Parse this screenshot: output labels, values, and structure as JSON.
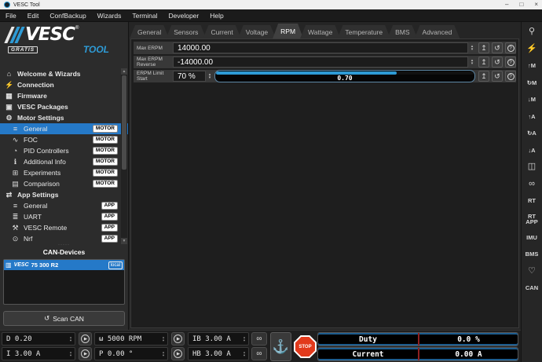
{
  "window": {
    "title": "VESC Tool",
    "controls": {
      "minimize": "–",
      "maximize": "□",
      "close": "×"
    }
  },
  "menu_bar": {
    "items": [
      "File",
      "Edit",
      "ConfBackup",
      "Wizards",
      "Terminal",
      "Developer",
      "Help"
    ]
  },
  "sidebar": {
    "logo": {
      "brand": "VESC",
      "registered": "®",
      "badge": "GRATIS",
      "sub": "TOOL"
    },
    "nav": [
      {
        "icon": "⌂",
        "label": "Welcome & Wizards",
        "badge": ""
      },
      {
        "icon": "⚡",
        "label": "Connection",
        "badge": ""
      },
      {
        "icon": "▦",
        "label": "Firmware",
        "badge": ""
      },
      {
        "icon": "▣",
        "label": "VESC Packages",
        "badge": ""
      },
      {
        "icon": "⚙",
        "label": "Motor Settings",
        "badge": ""
      },
      {
        "icon": "≡",
        "label": "General",
        "badge": "MOTOR"
      },
      {
        "icon": "∿",
        "label": "FOC",
        "badge": "MOTOR"
      },
      {
        "icon": "◔",
        "label": "PID Controllers",
        "badge": "MOTOR"
      },
      {
        "icon": "ℹ",
        "label": "Additional Info",
        "badge": "MOTOR"
      },
      {
        "icon": "⊞",
        "label": "Experiments",
        "badge": "MOTOR"
      },
      {
        "icon": "▤",
        "label": "Comparison",
        "badge": "MOTOR"
      },
      {
        "icon": "⇄",
        "label": "App Settings",
        "badge": ""
      },
      {
        "icon": "≡",
        "label": "General",
        "badge": "APP"
      },
      {
        "icon": "≣",
        "label": "UART",
        "badge": "APP"
      },
      {
        "icon": "⚒",
        "label": "VESC Remote",
        "badge": "APP"
      },
      {
        "icon": "⊙",
        "label": "Nrf",
        "badge": "APP"
      }
    ],
    "can": {
      "header": "CAN-Devices",
      "device": {
        "icon": "▥",
        "brand": "VESC",
        "name": "75 300 R2",
        "badge": "local"
      },
      "scan": {
        "icon": "↺",
        "label": "Scan CAN"
      }
    }
  },
  "tabs": {
    "items": [
      {
        "label": "General"
      },
      {
        "label": "Sensors"
      },
      {
        "label": "Current"
      },
      {
        "label": "Voltage"
      },
      {
        "label": "RPM"
      },
      {
        "label": "Wattage"
      },
      {
        "label": "Temperature"
      },
      {
        "label": "BMS"
      },
      {
        "label": "Advanced"
      }
    ],
    "active": "RPM"
  },
  "params": [
    {
      "label": "Max ERPM",
      "value": "14000.00"
    },
    {
      "label": "Max ERPM Reverse",
      "value": "-14000.00"
    },
    {
      "label": "ERPM Limit Start",
      "value": "70 %",
      "bar_value": "0.70",
      "bar_fill_pct": 70
    }
  ],
  "param_buttons": {
    "upload": "↥",
    "restore": "↺",
    "help": "?"
  },
  "right_toolbar": {
    "items": [
      {
        "glyph": "⚲"
      },
      {
        "glyph": "⚡"
      },
      {
        "glyph": "↑M"
      },
      {
        "glyph": "↻M"
      },
      {
        "glyph": "↓M"
      },
      {
        "glyph": "↑A"
      },
      {
        "glyph": "↻A"
      },
      {
        "glyph": "↓A"
      },
      {
        "glyph": "◫"
      },
      {
        "glyph": "∞"
      },
      {
        "glyph": "RT"
      },
      {
        "glyph": "RT APP"
      },
      {
        "glyph": "IMU"
      },
      {
        "glyph": "BMS"
      },
      {
        "glyph": "♡"
      },
      {
        "glyph": "CAN"
      }
    ]
  },
  "bottom_bar": {
    "controls": [
      {
        "value": "D 0.20"
      },
      {
        "value": "ω 5000 RPM"
      },
      {
        "value": "IB 3.00 A"
      },
      {
        "value": "I 3.00 A"
      },
      {
        "value": "P 0.00 °"
      },
      {
        "value": "HB 3.00 A"
      }
    ],
    "play_glyph": "▶",
    "gamepad_glyph": "∞",
    "anchor_glyph": "⚓",
    "stop_label": "STOP",
    "displays": [
      {
        "label": "Duty",
        "value": "0.0 %"
      },
      {
        "label": "Current",
        "value": "0.00 A"
      }
    ]
  },
  "colors": {
    "accent": "#2e9bd6",
    "selection": "#2579c8",
    "stop_red": "#e23a1c",
    "display_line": "#1d5d8f",
    "tick_red": "#8f2121",
    "badge_bg": "#ffffff"
  }
}
